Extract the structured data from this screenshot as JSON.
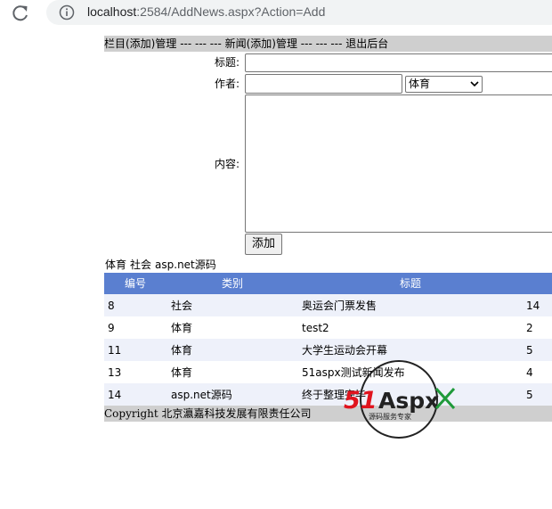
{
  "browser": {
    "url_host": "localhost",
    "url_rest": ":2584/AddNews.aspx?Action=Add"
  },
  "nav": {
    "category_admin": "栏目(添加)管理",
    "sep1": " --- --- --- ",
    "news_admin": "新闻(添加)管理",
    "sep2": " --- --- --- ",
    "logout": "退出后台"
  },
  "form": {
    "title_label": "标题:",
    "author_label": "作者:",
    "content_label": "内容:",
    "title_value": "",
    "author_value": "",
    "category_selected": "体育",
    "content_value": "",
    "submit_label": "添加"
  },
  "categories": [
    "体育",
    "社会",
    "asp.net源码"
  ],
  "table": {
    "headers": [
      "编号",
      "类别",
      "标题"
    ],
    "rows": [
      {
        "id": "8",
        "category": "社会",
        "title": "奥运会门票发售",
        "count": "14"
      },
      {
        "id": "9",
        "category": "体育",
        "title": "test2",
        "count": "2"
      },
      {
        "id": "11",
        "category": "体育",
        "title": "大学生运动会开幕",
        "count": "5"
      },
      {
        "id": "13",
        "category": "体育",
        "title": "51aspx测试新闻发布",
        "count": "4"
      },
      {
        "id": "14",
        "category": "asp.net源码",
        "title": "终于整理完毕",
        "count": "5"
      }
    ]
  },
  "footer": {
    "copyright": "Copyright 北京瀛嘉科技发展有限责任公司"
  },
  "watermark": {
    "brand_51": "51",
    "brand_aspx": "Aspx",
    "tagline": "源码服务专家"
  },
  "colors": {
    "header_blue": "#5a7fd0",
    "bar_gray": "#cfcfcf",
    "row_alt": "#eef1fa",
    "logo_red": "#e0141e",
    "logo_green": "#1f9a3a"
  }
}
